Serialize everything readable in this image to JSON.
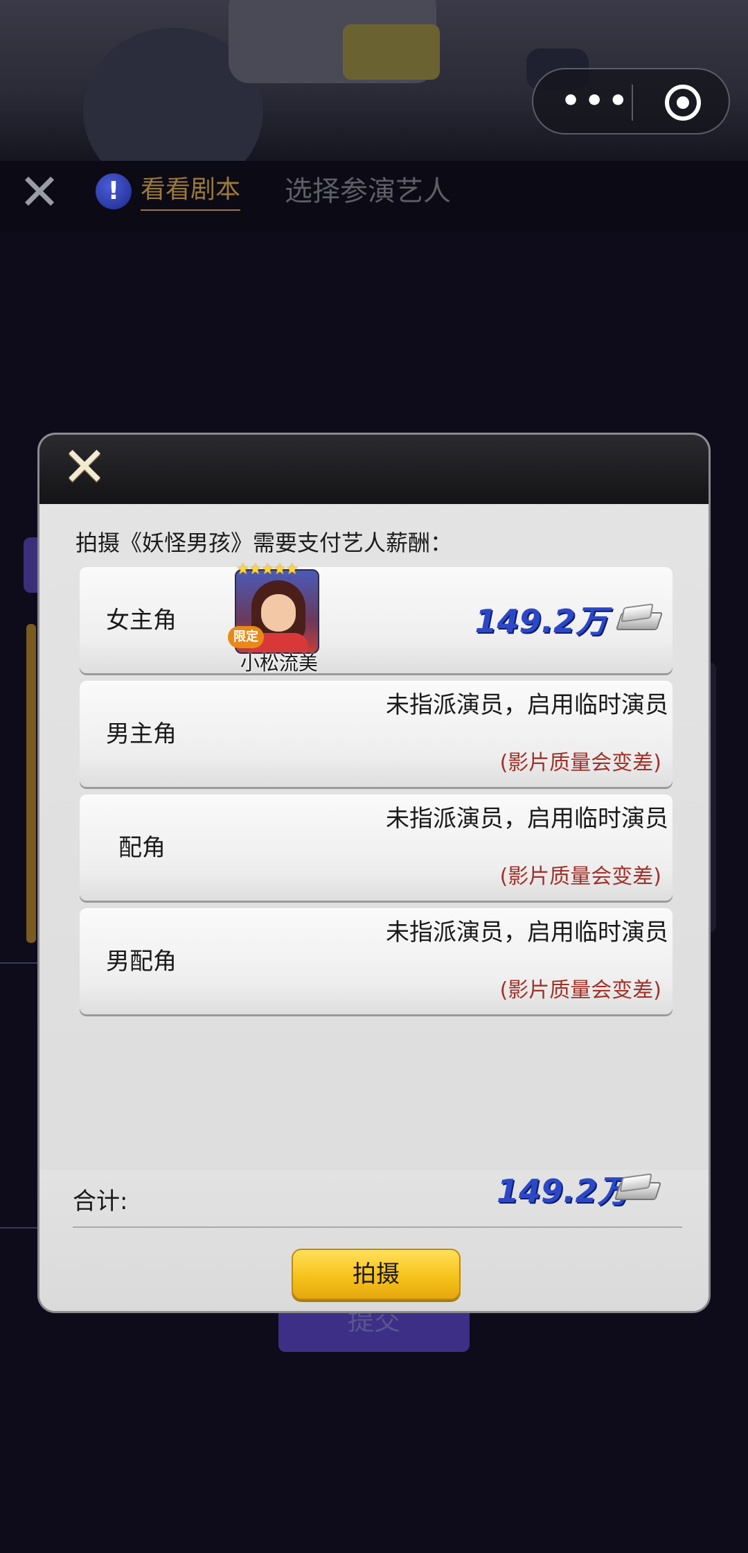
{
  "header": {
    "script_link": "看看剧本",
    "title": "选择参演艺人",
    "capsule_more": "•••"
  },
  "background": {
    "submit_label": "提交"
  },
  "modal": {
    "pay_text": "拍摄《妖怪男孩》需要支付艺人薪酬：",
    "roles": [
      {
        "label": "女主角",
        "actor_name": "小松流美",
        "badge": "限定",
        "stars": 5,
        "price": "149.2万"
      },
      {
        "label": "男主角",
        "status": "未指派演员，启用临时演员",
        "warning": "(影片质量会变差)"
      },
      {
        "label": "配角",
        "status": "未指派演员，启用临时演员",
        "warning": "(影片质量会变差)"
      },
      {
        "label": "男配角",
        "status": "未指派演员，启用临时演员",
        "warning": "(影片质量会变差)"
      }
    ],
    "total_label": "合计:",
    "total_price": "149.2万",
    "shoot_button": "拍摄"
  },
  "colors": {
    "price_blue": "#2c48c8",
    "warning_red": "#a0322a",
    "button_yellow": "#f7c21a",
    "link_gold": "#9a7a3c"
  },
  "icons": [
    "close-icon",
    "info-icon",
    "more-icon",
    "target-icon",
    "money-stack-icon",
    "star-icon"
  ]
}
